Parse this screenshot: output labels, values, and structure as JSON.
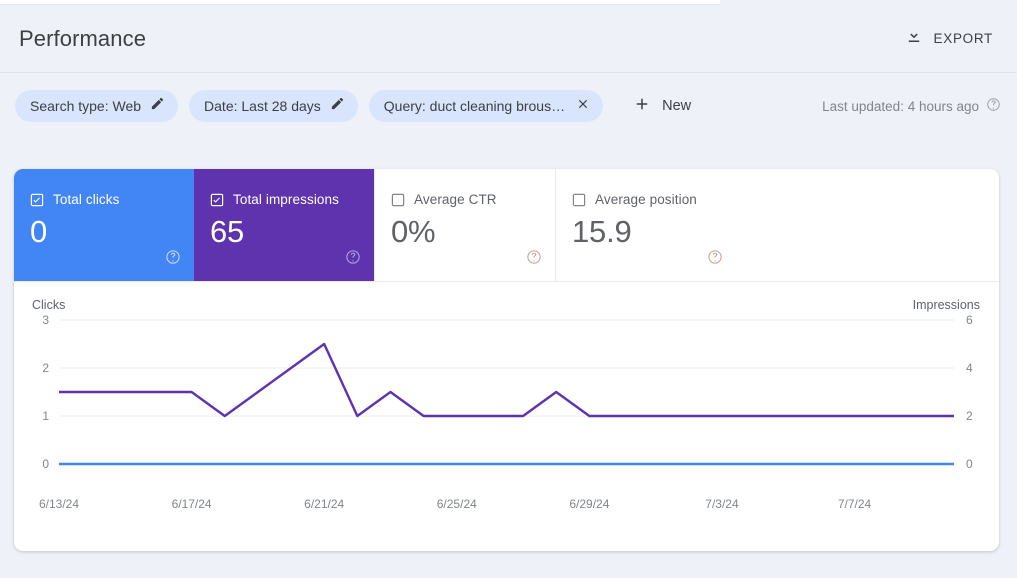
{
  "header": {
    "title": "Performance",
    "export_label": "EXPORT",
    "export_icon": "download-icon"
  },
  "filters": {
    "chips": [
      {
        "label": "Search type: Web",
        "action_icon": "pencil-icon"
      },
      {
        "label": "Date: Last 28 days",
        "action_icon": "pencil-icon"
      },
      {
        "label": "Query: duct cleaning brous…",
        "action_icon": "close-icon"
      }
    ],
    "new_label": "New",
    "new_icon": "plus-icon",
    "last_updated": "Last updated: 4 hours ago",
    "last_updated_icon": "help-circle-icon"
  },
  "metrics": [
    {
      "name": "Total clicks",
      "value": "0",
      "checked": true,
      "state": "selected",
      "color": "#4285f4",
      "help_icon": "help-circle-icon"
    },
    {
      "name": "Total impressions",
      "value": "65",
      "checked": true,
      "state": "selected",
      "color": "#5f33ae",
      "help_icon": "help-circle-icon"
    },
    {
      "name": "Average CTR",
      "value": "0%",
      "checked": false,
      "state": "unselected",
      "color": "#ffffff",
      "help_icon": "help-circle-icon"
    },
    {
      "name": "Average position",
      "value": "15.9",
      "checked": false,
      "state": "unselected",
      "color": "#ffffff",
      "help_icon": "help-circle-icon"
    }
  ],
  "chart_data": {
    "type": "line",
    "title": "",
    "xlabel": "",
    "grid": true,
    "legend": "none",
    "x_tick_labels": [
      "6/13/24",
      "6/17/24",
      "6/21/24",
      "6/25/24",
      "6/29/24",
      "7/3/24",
      "7/7/24"
    ],
    "x_range": [
      "6/13/24",
      "7/10/24"
    ],
    "axes": [
      {
        "id": "left",
        "label": "Clicks",
        "ticks": [
          0,
          1,
          2,
          3
        ],
        "ylim": [
          0,
          3
        ],
        "color": "#4285f4"
      },
      {
        "id": "right",
        "label": "Impressions",
        "ticks": [
          0,
          2,
          4,
          6
        ],
        "ylim": [
          0,
          6
        ],
        "color": "#5f33ae"
      }
    ],
    "series": [
      {
        "name": "Clicks",
        "axis": "left",
        "color": "#4285f4",
        "values": [
          0,
          0,
          0,
          0,
          0,
          0,
          0,
          0,
          0,
          0,
          0,
          0,
          0,
          0,
          0,
          0,
          0,
          0,
          0,
          0,
          0,
          0,
          0,
          0,
          0,
          0,
          0,
          0
        ]
      },
      {
        "name": "Impressions",
        "axis": "right",
        "color": "#5f33ae",
        "values": [
          3,
          3,
          3,
          3,
          3,
          2,
          3,
          4,
          5,
          2,
          3,
          2,
          2,
          2,
          2,
          3,
          2,
          2,
          2,
          2,
          2,
          2,
          2,
          2,
          2,
          2,
          2,
          2
        ]
      }
    ]
  }
}
